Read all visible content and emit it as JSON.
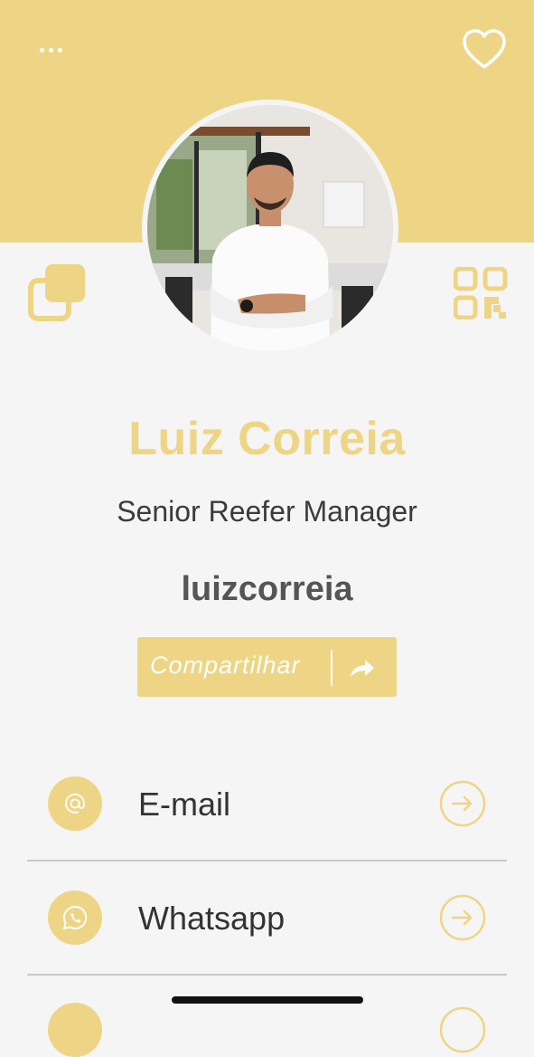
{
  "profile": {
    "name": "Luiz Correia",
    "job_title": "Senior Reefer Manager",
    "username": "luizcorreia"
  },
  "share": {
    "label": "Compartilhar"
  },
  "contacts": [
    {
      "label": "E-mail",
      "icon": "at-icon"
    },
    {
      "label": "Whatsapp",
      "icon": "whatsapp-icon"
    }
  ],
  "icons": {
    "menu": "more-dots-icon",
    "favorite": "heart-icon",
    "copy": "copy-icon",
    "qr": "qr-code-icon",
    "share": "share-arrow-icon",
    "row_arrow": "arrow-right-circle-icon"
  },
  "colors": {
    "accent": "#eed585",
    "background": "#f5f5f5",
    "text_dark": "#333333"
  }
}
